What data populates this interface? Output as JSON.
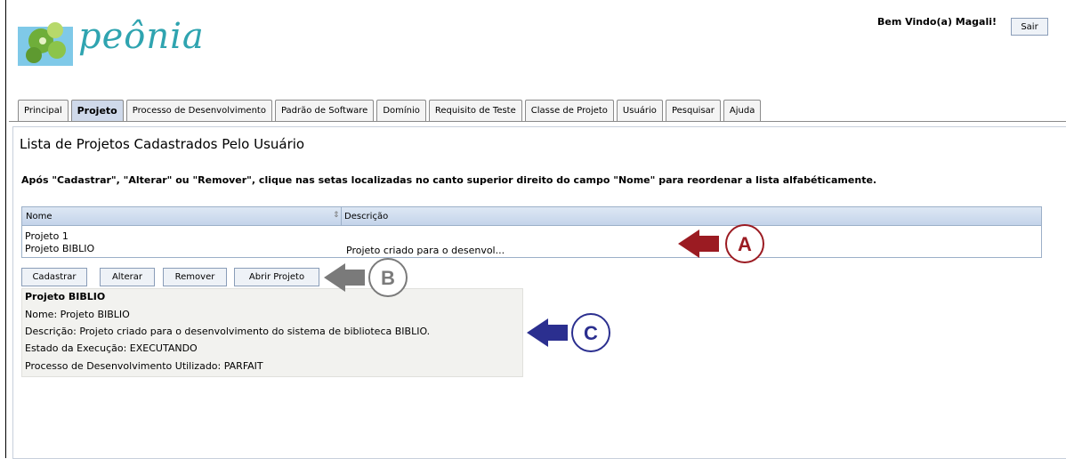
{
  "header": {
    "logo_text": "peônia",
    "welcome": "Bem Vindo(a) Magali!",
    "logout_label": "Sair"
  },
  "tabs": [
    {
      "label": "Principal"
    },
    {
      "label": "Projeto",
      "active": true
    },
    {
      "label": "Processo de Desenvolvimento"
    },
    {
      "label": "Padrão de Software"
    },
    {
      "label": "Domínio"
    },
    {
      "label": "Requisito de Teste"
    },
    {
      "label": "Classe de Projeto"
    },
    {
      "label": "Usuário"
    },
    {
      "label": "Pesquisar"
    },
    {
      "label": "Ajuda"
    }
  ],
  "main": {
    "title": "Lista de Projetos Cadastrados Pelo Usuário",
    "hint": "Após \"Cadastrar\", \"Alterar\" ou \"Remover\", clique nas setas localizadas no canto superior direito do campo \"Nome\" para reordenar a lista alfabéticamente."
  },
  "grid": {
    "columns": [
      "Nome",
      "Descrição"
    ],
    "rows": [
      {
        "nome": "Projeto 1",
        "descricao": ""
      },
      {
        "nome": "Projeto BIBLIO",
        "descricao": "Projeto criado para o desenvol..."
      }
    ]
  },
  "actions": {
    "cadastrar": "Cadastrar",
    "alterar": "Alterar",
    "remover": "Remover",
    "abrir": "Abrir Projeto"
  },
  "details": {
    "heading": "Projeto BIBLIO",
    "nome": "Nome: Projeto BIBLIO",
    "descricao": "Descrição: Projeto criado para o desenvolvimento do sistema de biblioteca BIBLIO.",
    "estado": "Estado da Execução: EXECUTANDO",
    "processo": "Processo de Desenvolvimento Utilizado: PARFAIT"
  },
  "annotations": {
    "a": "A",
    "b": "B",
    "c": "C",
    "colors": {
      "a": "#9b1b22",
      "b": "#7a7a7a",
      "c": "#2b2f8f"
    }
  }
}
